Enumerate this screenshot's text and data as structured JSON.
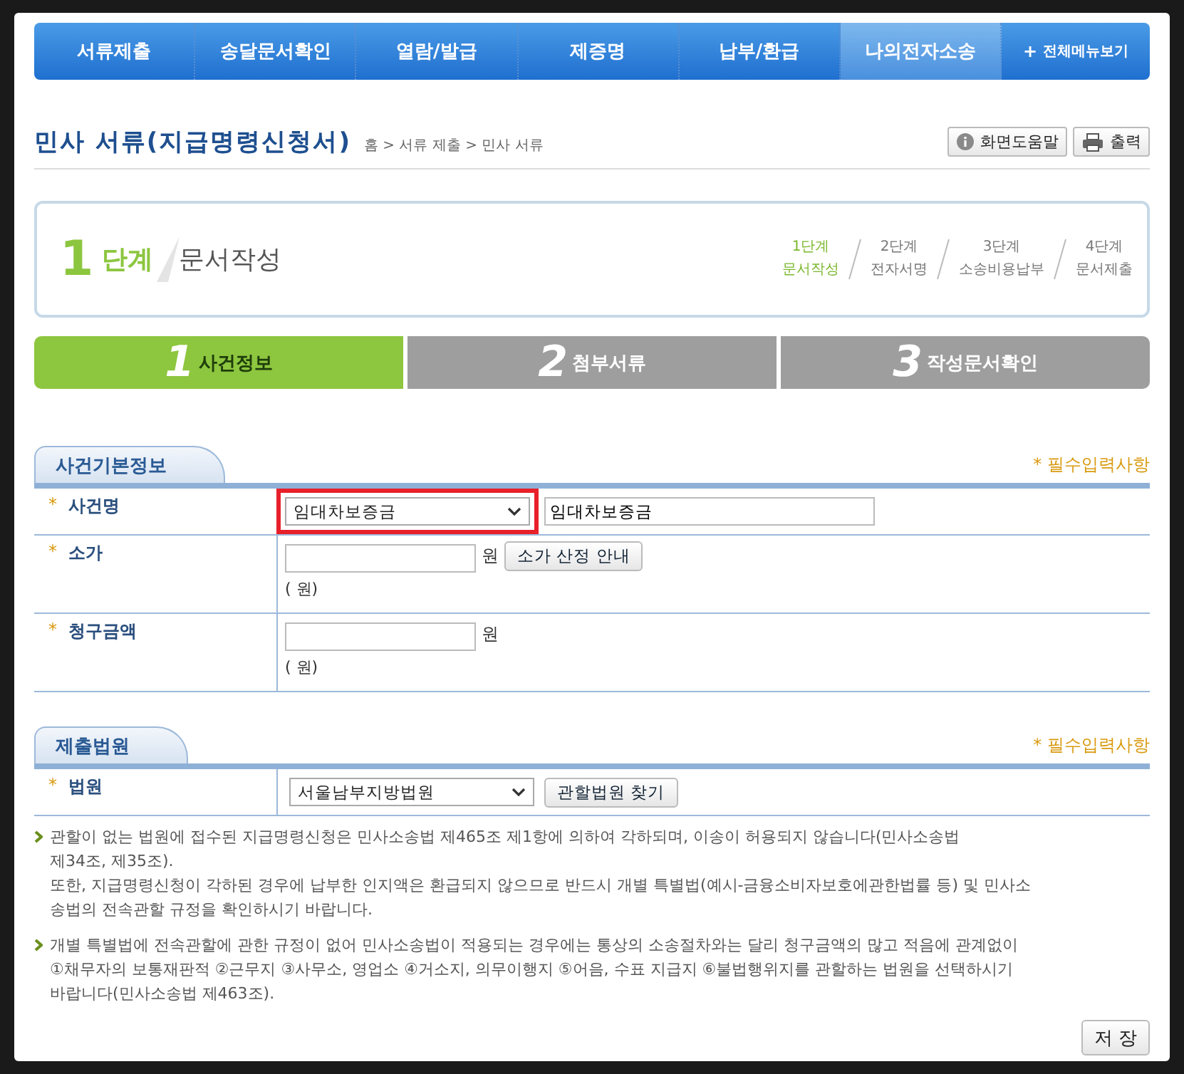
{
  "nav": [
    {
      "label": "서류제출",
      "selected": false,
      "kind": "menu"
    },
    {
      "label": "송달문서확인",
      "selected": false,
      "kind": "menu"
    },
    {
      "label": "열람/발급",
      "selected": false,
      "kind": "menu"
    },
    {
      "label": "제증명",
      "selected": false,
      "kind": "menu"
    },
    {
      "label": "납부/환급",
      "selected": false,
      "kind": "menu"
    },
    {
      "label": "나의전자소송",
      "selected": true,
      "kind": "menu"
    },
    {
      "label": "전체메뉴보기",
      "selected": false,
      "kind": "all",
      "icon": "+"
    }
  ],
  "page": {
    "title": "민사 서류(지급명령신청서)",
    "breadcrumb": "홈 > 서류 제출 > 민사 서류",
    "buttons": [
      {
        "label": "화면도움말",
        "kind": "help"
      },
      {
        "label": "출력",
        "kind": "print"
      }
    ]
  },
  "stage": {
    "number": "1",
    "unit": "단계",
    "name": "문서작성",
    "steps": [
      {
        "step": "1단계",
        "name": "문서작성",
        "selected": true
      },
      {
        "step": "2단계",
        "name": "전자서명",
        "selected": false
      },
      {
        "step": "3단계",
        "name": "소송비용납부",
        "selected": false
      },
      {
        "step": "4단계",
        "name": "문서제출",
        "selected": false
      }
    ]
  },
  "tabs": [
    {
      "number": "1",
      "label": "사건정보",
      "selected": true
    },
    {
      "number": "2",
      "label": "첨부서류",
      "selected": false
    },
    {
      "number": "3",
      "label": "작성문서확인",
      "selected": false
    }
  ],
  "sections": [
    {
      "title": "사건기본정보",
      "required_note": "* 필수입력사항",
      "rows": [
        {
          "mark": "*",
          "label": "사건명",
          "select": {
            "value": "임대차보증금",
            "highlight": true
          },
          "input": {
            "value": "임대차보증금"
          }
        },
        {
          "mark": "*",
          "label": "소가",
          "kind": "amount",
          "unit": "원",
          "button": "소가 산정 안내",
          "note": "( 원)"
        },
        {
          "mark": "*",
          "label": "청구금액",
          "kind": "amount",
          "unit": "원",
          "note": "( 원)"
        }
      ]
    },
    {
      "title": "제출법원",
      "required_note": "* 필수입력사항",
      "rows": [
        {
          "mark": "*",
          "label": "법원",
          "select": {
            "value": "서울남부지방법원",
            "highlight": false
          },
          "button": "관할법원 찾기"
        }
      ]
    }
  ],
  "notes": [
    [
      "관할이 없는 법원에 접수된 지급명령신청은 민사소송법 제465조 제1항에 의하여 각하되며, 이송이 허용되지 않습니다(민사소송법",
      "제34조, 제35조).",
      "또한, 지급명령신청이 각하된 경우에 납부한 인지액은 환급되지 않으므로 반드시 개별 특별법(예시-금융소비자보호에관한법률 등) 및 민사소",
      "송법의 전속관할 규정을 확인하시기 바랍니다."
    ],
    [
      "개별 특별법에 전속관할에 관한 규정이 없어 민사소송법이 적용되는 경우에는 통상의 소송절차와는 달리 청구금액의 많고 적음에 관계없이",
      "①채무자의 보통재판적 ②근무지 ③사무소, 영업소 ④거소지, 의무이행지 ⑤어음, 수표 지급지 ⑥불법행위지를 관할하는 법원을 선택하시기",
      "바랍니다(민사소송법 제463조)."
    ]
  ],
  "save_button": "저 장"
}
